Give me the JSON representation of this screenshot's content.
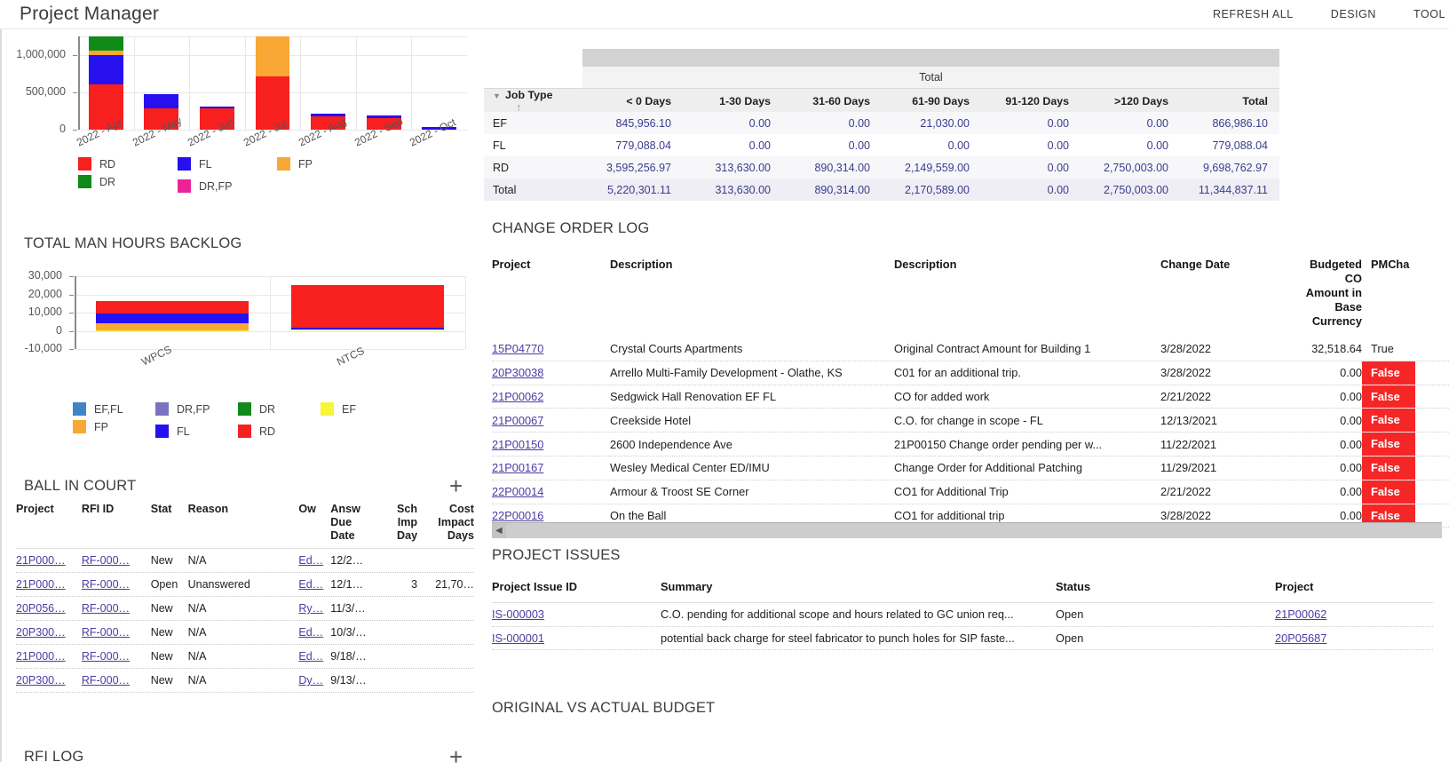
{
  "header": {
    "title": "Project Manager",
    "menu": [
      "REFRESH ALL",
      "DESIGN",
      "TOOL"
    ]
  },
  "chart_data": [
    {
      "type": "bar",
      "title": "",
      "stacked": true,
      "categories": [
        "2022 - Apr",
        "2022 - May",
        "2022 - Jun",
        "2022 - Jul",
        "2022 - Aug",
        "2022 - Sep",
        "2022 - Oct"
      ],
      "ylim": [
        0,
        1250000
      ],
      "yticks": [
        0,
        500000,
        1000000
      ],
      "yticklabels": [
        "0",
        "500,000",
        "1,000,000"
      ],
      "xlabel": "",
      "ylabel": "",
      "grid": true,
      "legend_position": "bottom",
      "series": [
        {
          "name": "RD",
          "color": "#f81f1f",
          "values": [
            610000,
            285000,
            290000,
            720000,
            180000,
            160000,
            0
          ]
        },
        {
          "name": "FL",
          "color": "#2610ef",
          "values": [
            390000,
            195000,
            20000,
            0,
            30000,
            35000,
            40000
          ]
        },
        {
          "name": "FP",
          "color": "#f9a735",
          "values": [
            60000,
            0,
            0,
            530000,
            0,
            0,
            0
          ]
        },
        {
          "name": "DR",
          "color": "#108a18",
          "values": [
            190000,
            0,
            0,
            0,
            0,
            0,
            0
          ]
        },
        {
          "name": "DR,FP",
          "color": "#ec2396",
          "values": [
            0,
            0,
            0,
            0,
            0,
            0,
            0
          ]
        }
      ]
    },
    {
      "type": "bar",
      "title": "TOTAL MAN HOURS BACKLOG",
      "stacked": true,
      "categories": [
        "WPCS",
        "NTCS"
      ],
      "ylim": [
        -10000,
        30000
      ],
      "yticks": [
        -10000,
        0,
        10000,
        20000,
        30000
      ],
      "yticklabels": [
        "-10,000",
        "0",
        "10,000",
        "20,000",
        "30,000"
      ],
      "xlabel": "",
      "ylabel": "",
      "grid": true,
      "legend_position": "bottom",
      "series": [
        {
          "name": "EF,FL",
          "color": "#3d85c8",
          "values": [
            0,
            0
          ]
        },
        {
          "name": "DR,FP",
          "color": "#7c73c0",
          "values": [
            0,
            0
          ]
        },
        {
          "name": "DR",
          "color": "#108a18",
          "values": [
            0,
            0
          ]
        },
        {
          "name": "EF",
          "color": "#f7f43a",
          "values": [
            300,
            500
          ]
        },
        {
          "name": "FP",
          "color": "#f9a735",
          "values": [
            3800,
            0
          ]
        },
        {
          "name": "FL",
          "color": "#2610ef",
          "values": [
            5600,
            1300
          ]
        },
        {
          "name": "RD",
          "color": "#f81f1f",
          "values": [
            6700,
            23500
          ]
        }
      ]
    }
  ],
  "aging": {
    "band_label": "Total",
    "columns": [
      "Job Type",
      "< 0 Days",
      "1-30 Days",
      "31-60 Days",
      "61-90 Days",
      "91-120 Days",
      ">120 Days",
      "Total"
    ],
    "rows": [
      {
        "job_type": "EF",
        "values": [
          "845,956.10",
          "0.00",
          "0.00",
          "21,030.00",
          "0.00",
          "0.00",
          "866,986.10"
        ]
      },
      {
        "job_type": "FL",
        "values": [
          "779,088.04",
          "0.00",
          "0.00",
          "0.00",
          "0.00",
          "0.00",
          "779,088.04"
        ]
      },
      {
        "job_type": "RD",
        "values": [
          "3,595,256.97",
          "313,630.00",
          "890,314.00",
          "2,149,559.00",
          "0.00",
          "2,750,003.00",
          "9,698,762.97"
        ]
      },
      {
        "job_type": "Total",
        "values": [
          "5,220,301.11",
          "313,630.00",
          "890,314.00",
          "2,170,589.00",
          "0.00",
          "2,750,003.00",
          "11,344,837.11"
        ]
      }
    ]
  },
  "change_order_log": {
    "title": "CHANGE ORDER LOG",
    "columns": [
      "Project",
      "Description",
      "Description",
      "Change Date",
      "Budgeted CO Amount in Base Currency",
      "PMCha"
    ],
    "col_amount_lines": [
      "Budgeted",
      "CO",
      "Amount in",
      "Base",
      "Currency"
    ],
    "col_amount_first": "Budgeted",
    "col_flag": "PMCha",
    "rows": [
      {
        "project": "15P04770",
        "desc1": "Crystal Courts Apartments",
        "desc2": "Original Contract Amount for Building 1",
        "date": "3/28/2022",
        "amount": "32,518.64",
        "flag": "True"
      },
      {
        "project": "20P30038",
        "desc1": "Arrello Multi-Family Development - Olathe, KS",
        "desc2": "C01 for an additional trip.",
        "date": "3/28/2022",
        "amount": "0.00",
        "flag": "False"
      },
      {
        "project": "21P00062",
        "desc1": "Sedgwick Hall Renovation EF FL",
        "desc2": "CO for added work",
        "date": "2/21/2022",
        "amount": "0.00",
        "flag": "False"
      },
      {
        "project": "21P00067",
        "desc1": "Creekside Hotel",
        "desc2": "C.O. for change in scope - FL",
        "date": "12/13/2021",
        "amount": "0.00",
        "flag": "False"
      },
      {
        "project": "21P00150",
        "desc1": "2600 Independence Ave",
        "desc2": "21P00150 Change order pending per w...",
        "date": "11/22/2021",
        "amount": "0.00",
        "flag": "False"
      },
      {
        "project": "21P00167",
        "desc1": "Wesley Medical Center ED/IMU",
        "desc2": "Change Order for Additional Patching",
        "date": "11/29/2021",
        "amount": "0.00",
        "flag": "False"
      },
      {
        "project": "22P00014",
        "desc1": "Armour & Troost SE Corner",
        "desc2": "CO1 for Additional Trip",
        "date": "2/21/2022",
        "amount": "0.00",
        "flag": "False"
      },
      {
        "project": "22P00016",
        "desc1": "On the Ball",
        "desc2": "CO1 for additional trip",
        "date": "3/28/2022",
        "amount": "0.00",
        "flag": "False"
      }
    ]
  },
  "project_issues": {
    "title": "PROJECT ISSUES",
    "columns": [
      "Project Issue ID",
      "Summary",
      "Status",
      "Project"
    ],
    "rows": [
      {
        "id": "IS-000003",
        "summary": "C.O. pending for additional scope and hours related to GC union req...",
        "status": "Open",
        "project": "21P00062"
      },
      {
        "id": "IS-000001",
        "summary": "potential back charge for steel fabricator to punch holes for SIP faste...",
        "status": "Open",
        "project": "20P05687"
      }
    ]
  },
  "ball_in_court": {
    "title": "BALL IN COURT",
    "add_label": "+",
    "columns": [
      "Project",
      "RFI ID",
      "Stat",
      "Reason",
      "Ow",
      "Answ Due Date",
      "Sch Imp Day",
      "Cost Impact Days"
    ],
    "col_lines": {
      "answer": [
        "Answ",
        "Due",
        "Date"
      ],
      "sched": [
        "Sch",
        "Imp",
        "Day"
      ],
      "cost": [
        "Cost",
        "Impact",
        "Days"
      ]
    },
    "rows": [
      {
        "project": "21P000…",
        "rfi": "RF-000…",
        "status": "New",
        "reason": "N/A",
        "owner": "Ed…",
        "due": "12/2…",
        "sched": "",
        "cost": ""
      },
      {
        "project": "21P000…",
        "rfi": "RF-000…",
        "status": "Open",
        "reason": "Unanswered",
        "owner": "Ed…",
        "due": "12/1…",
        "sched": "3",
        "cost": "21,70…"
      },
      {
        "project": "20P056…",
        "rfi": "RF-000…",
        "status": "New",
        "reason": "N/A",
        "owner": "Ry…",
        "due": "11/3/…",
        "sched": "",
        "cost": ""
      },
      {
        "project": "20P300…",
        "rfi": "RF-000…",
        "status": "New",
        "reason": "N/A",
        "owner": "Ed…",
        "due": "10/3/…",
        "sched": "",
        "cost": ""
      },
      {
        "project": "21P000…",
        "rfi": "RF-000…",
        "status": "New",
        "reason": "N/A",
        "owner": "Ed…",
        "due": "9/18/…",
        "sched": "",
        "cost": ""
      },
      {
        "project": "20P300…",
        "rfi": "RF-000…",
        "status": "New",
        "reason": "N/A",
        "owner": "Dy…",
        "due": "9/13/…",
        "sched": "",
        "cost": ""
      }
    ]
  },
  "rfi_log": {
    "title": "RFI LOG",
    "add_label": "+"
  },
  "original_vs_actual": {
    "title": "ORIGINAL VS ACTUAL BUDGET"
  }
}
